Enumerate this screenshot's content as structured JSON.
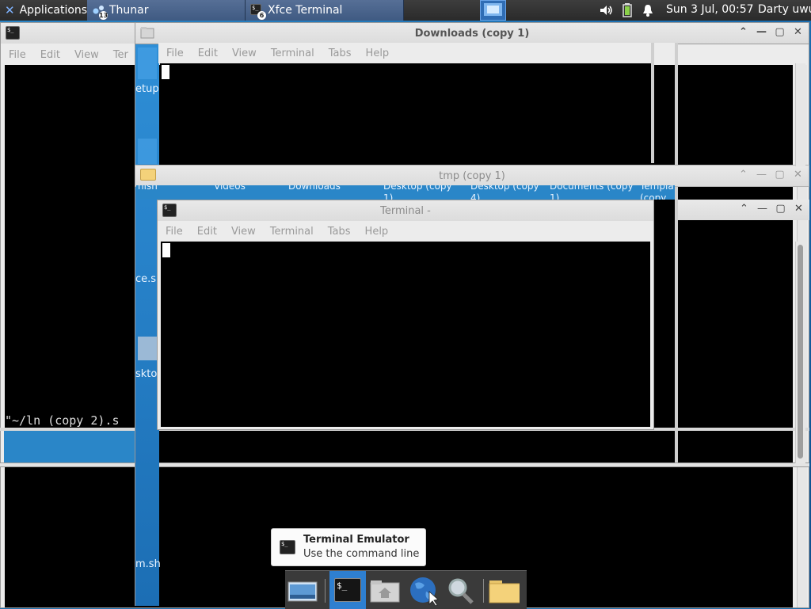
{
  "top_panel": {
    "applications_label": "Applications",
    "thunar_label": "Thunar",
    "thunar_count": "13",
    "terminal_label": "Xfce Terminal",
    "terminal_count": "6",
    "clock": "Sun  3 Jul, 00:57",
    "user": "Darty uwu"
  },
  "windows": {
    "back_terminal": {
      "menu": [
        "File",
        "Edit",
        "View",
        "Ter"
      ],
      "prompt_line": "\"~/ln (copy 2).s"
    },
    "downloads": {
      "title": "Downloads (copy 1)",
      "menu": [
        "File",
        "Edit",
        "View",
        "Terminal",
        "Tabs",
        "Help"
      ]
    },
    "tmp": {
      "title": "tmp (copy 1)",
      "folder_labels": [
        "nish",
        "Videos",
        "Downloads",
        "Desktop (copy 1)",
        "Desktop (copy 4)",
        "Documents (copy 1)",
        "Templa (copy"
      ]
    },
    "front_terminal": {
      "title": "Terminal -",
      "menu": [
        "File",
        "Edit",
        "View",
        "Terminal",
        "Tabs",
        "Help"
      ]
    }
  },
  "side_labels": [
    "etup",
    "ce.sh",
    "skto",
    "m.sh"
  ],
  "tooltip": {
    "title": "Terminal Emulator",
    "subtitle": "Use the command line"
  },
  "dock": {
    "items": [
      "show-desktop",
      "terminal-emulator",
      "home-folder",
      "web-browser",
      "app-finder",
      "file-manager"
    ]
  },
  "colors": {
    "panel_bg": "#2f2f2f",
    "task_active": "#4b6690",
    "desktop": "#1b6fb0",
    "terminal_bg": "#000000"
  }
}
